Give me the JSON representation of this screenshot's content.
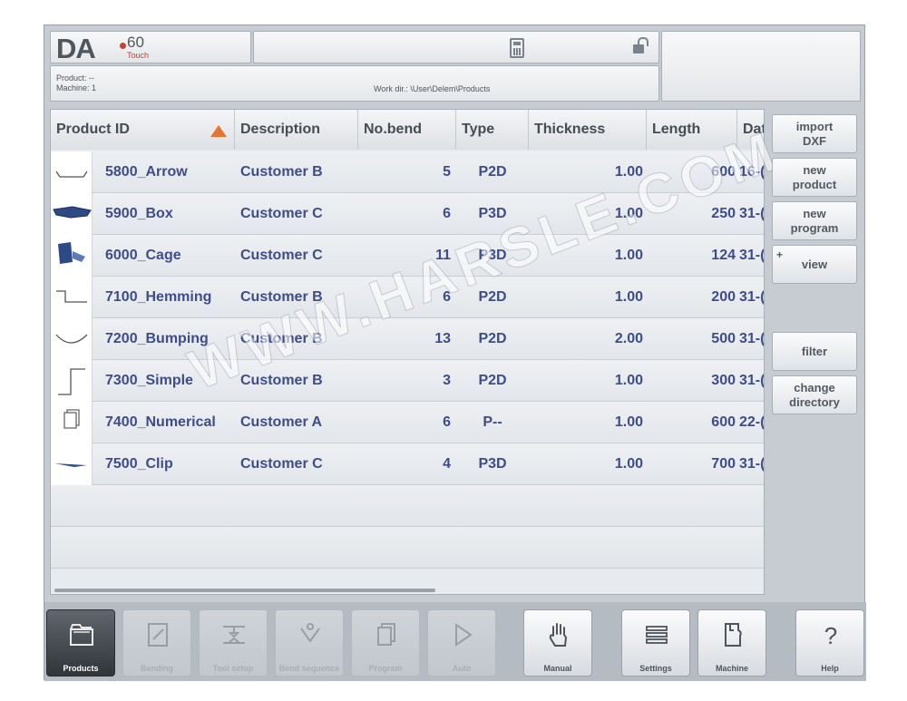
{
  "header": {
    "logo": {
      "brand": "DA",
      "model": "60",
      "edition": "Touch"
    },
    "info": {
      "product": "Product: --",
      "machine": "Machine: 1",
      "work_dir": "Work dir.: \\User\\Delem\\Products"
    }
  },
  "table": {
    "columns": [
      "Product ID",
      "Description",
      "No.bend",
      "Type",
      "Thickness",
      "Length",
      "Dat"
    ],
    "sort_column": "Product ID",
    "rows": [
      {
        "thumb": "arrow-profile-icon",
        "id": "5800_Arrow",
        "desc": "Customer B",
        "bends": "5",
        "type": "P2D",
        "thickness": "1.00",
        "length": "600",
        "date": "16-("
      },
      {
        "thumb": "box-3d-icon",
        "id": "5900_Box",
        "desc": "Customer C",
        "bends": "6",
        "type": "P3D",
        "thickness": "1.00",
        "length": "250",
        "date": "31-("
      },
      {
        "thumb": "cage-3d-icon",
        "id": "6000_Cage",
        "desc": "Customer C",
        "bends": "11",
        "type": "P3D",
        "thickness": "1.00",
        "length": "124",
        "date": "31-("
      },
      {
        "thumb": "hemming-profile-icon",
        "id": "7100_Hemming",
        "desc": "Customer B",
        "bends": "6",
        "type": "P2D",
        "thickness": "1.00",
        "length": "200",
        "date": "31-("
      },
      {
        "thumb": "bumping-profile-icon",
        "id": "7200_Bumping",
        "desc": "Customer B",
        "bends": "13",
        "type": "P2D",
        "thickness": "2.00",
        "length": "500",
        "date": "31-("
      },
      {
        "thumb": "simple-profile-icon",
        "id": "7300_Simple",
        "desc": "Customer B",
        "bends": "3",
        "type": "P2D",
        "thickness": "1.00",
        "length": "300",
        "date": "31-("
      },
      {
        "thumb": "numerical-program-icon",
        "id": "7400_Numerical",
        "desc": "Customer A",
        "bends": "6",
        "type": "P--",
        "thickness": "1.00",
        "length": "600",
        "date": "22-("
      },
      {
        "thumb": "clip-3d-icon",
        "id": "7500_Clip",
        "desc": "Customer C",
        "bends": "4",
        "type": "P3D",
        "thickness": "1.00",
        "length": "700",
        "date": "31-("
      }
    ]
  },
  "watermark": "WWW.HARSLE.COM",
  "side_buttons": [
    {
      "id": "import-dxf",
      "label": "import\nDXF"
    },
    {
      "id": "new-product",
      "label": "new\nproduct"
    },
    {
      "id": "new-program",
      "label": "new\nprogram"
    },
    {
      "id": "view",
      "label": "view",
      "plus": "+"
    },
    {
      "id": "filter",
      "label": "filter"
    },
    {
      "id": "change-directory",
      "label": "change\ndirectory"
    }
  ],
  "nav": [
    {
      "id": "products",
      "label": "Products",
      "state": "active",
      "icon": "folder-icon"
    },
    {
      "id": "bending",
      "label": "Bending",
      "state": "disabled",
      "icon": "drawing-icon"
    },
    {
      "id": "tool-setup",
      "label": "Tool setup",
      "state": "disabled",
      "icon": "tool-setup-icon"
    },
    {
      "id": "bend-sequence",
      "label": "Bend sequence",
      "state": "disabled",
      "icon": "bend-sequence-icon"
    },
    {
      "id": "program",
      "label": "Program",
      "state": "disabled",
      "icon": "program-pages-icon"
    },
    {
      "id": "auto",
      "label": "Auto",
      "state": "disabled",
      "icon": "play-icon"
    },
    {
      "id": "manual",
      "label": "Manual",
      "state": "enabled",
      "icon": "hand-icon"
    },
    {
      "id": "settings",
      "label": "Settings",
      "state": "enabled",
      "icon": "settings-list-icon"
    },
    {
      "id": "machine",
      "label": "Machine",
      "state": "enabled",
      "icon": "machine-icon"
    },
    {
      "id": "help",
      "label": "Help",
      "state": "enabled",
      "icon": "question-icon"
    }
  ],
  "colors": {
    "accent": "#e9732c",
    "table_text": "#3d4d8a",
    "brand_red": "#d43c2c"
  }
}
